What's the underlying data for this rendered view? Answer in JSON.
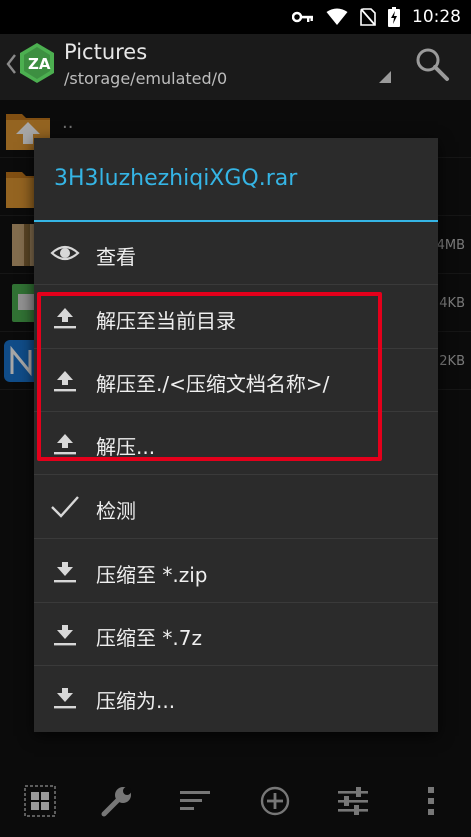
{
  "status_bar": {
    "time": "10:28",
    "icons": [
      "key-icon",
      "wifi-icon",
      "no-sim-icon",
      "battery-charging-icon"
    ]
  },
  "app_bar": {
    "title": "Pictures",
    "path": "/storage/emulated/0",
    "icons": [
      "back-chevron-icon",
      "zarchiver-logo-icon",
      "dropdown-triangle-icon",
      "search-icon"
    ]
  },
  "file_list": {
    "rows": [
      {
        "name": "..",
        "size": ""
      },
      {
        "name": "",
        "size": ""
      },
      {
        "name": "",
        "size": "4MB"
      },
      {
        "name": "",
        "size": "4KB"
      },
      {
        "name": "",
        "size": "2KB"
      }
    ]
  },
  "dialog": {
    "title": "3H3luzhezhiqiXGQ.rar",
    "items": [
      {
        "label": "查看",
        "icon": "eye-icon"
      },
      {
        "label": "解压至当前目录",
        "icon": "extract-upload-icon"
      },
      {
        "label": "解压至./<压缩文档名称>/",
        "icon": "extract-upload-icon"
      },
      {
        "label": "解压...",
        "icon": "extract-upload-icon"
      },
      {
        "label": "检测",
        "icon": "checkmark-icon"
      },
      {
        "label": "压缩至 *.zip",
        "icon": "compress-download-icon"
      },
      {
        "label": "压缩至 *.7z",
        "icon": "compress-download-icon"
      },
      {
        "label": "压缩为...",
        "icon": "compress-download-icon"
      }
    ]
  },
  "bottom_bar": {
    "icons": [
      "select-grid-icon",
      "wrench-icon",
      "sort-lines-icon",
      "add-circle-icon",
      "sliders-icon",
      "more-vertical-icon"
    ]
  },
  "colors": {
    "accent": "#35b5e5",
    "highlight": "#e4001b",
    "dialog_bg": "#2b2b2b",
    "logo_green": "#4caf50"
  }
}
